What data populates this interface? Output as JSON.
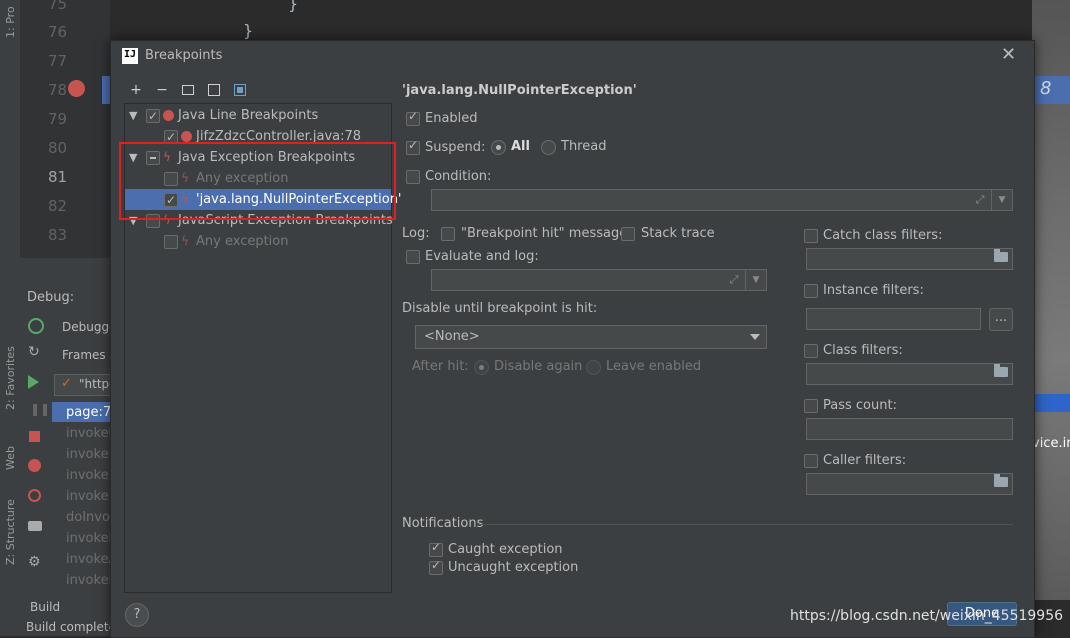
{
  "ide": {
    "left_tabs": [
      "1: Pro",
      "2: Favorites",
      "Web",
      "Z: Structure"
    ],
    "line_numbers": [
      "75",
      "76",
      "77",
      "78",
      "79",
      "80",
      "81",
      "82",
      "83"
    ],
    "code_braces": [
      "}",
      "}"
    ],
    "debug_label": "Debug:",
    "debugger_tab": "Debugge",
    "frames_tab": "Frames",
    "thread_value": "\"http-",
    "frames": [
      "page:78",
      "invoke0",
      "invoke:6",
      "invoke:4",
      "invoke:4",
      "doInvo",
      "invokeF",
      "invokeA",
      "invokeH"
    ],
    "build_label": "Build",
    "status_text": "Build complete",
    "right_snippet": "vice.im",
    "right_digit": "8"
  },
  "dialog": {
    "title": "Breakpoints",
    "close_icon": "close-icon",
    "toolbar": [
      "add-icon",
      "remove-icon",
      "group-folder-icon",
      "group-package-icon",
      "restore-icon"
    ],
    "tree": [
      {
        "label": "Java Line Breakpoints",
        "checked": true,
        "kind": "group"
      },
      {
        "label": "JifzZdzcController.java:78",
        "checked": true,
        "kind": "item"
      },
      {
        "label": "Java Exception Breakpoints",
        "checked": "mixed",
        "kind": "group"
      },
      {
        "label": "Any exception",
        "checked": false,
        "kind": "item"
      },
      {
        "label": "'java.lang.NullPointerException'",
        "checked": true,
        "kind": "item",
        "selected": true
      },
      {
        "label": "JavaScript Exception Breakpoints",
        "checked": false,
        "kind": "group"
      },
      {
        "label": "Any exception",
        "checked": false,
        "kind": "item"
      }
    ],
    "detail": {
      "heading": "'java.lang.NullPointerException'",
      "enabled": "Enabled",
      "suspend": "Suspend:",
      "all": "All",
      "thread": "Thread",
      "condition": "Condition:",
      "log": "Log:",
      "bp_hit_message": "\"Breakpoint hit\" message",
      "stack_trace": "Stack trace",
      "evaluate_and_log": "Evaluate and log:",
      "disable_until": "Disable until breakpoint is hit:",
      "none_option": "<None>",
      "after_hit": "After hit:",
      "disable_again": "Disable again",
      "leave_enabled": "Leave enabled",
      "catch_class_filters": "Catch class filters:",
      "instance_filters": "Instance filters:",
      "class_filters": "Class filters:",
      "pass_count": "Pass count:",
      "caller_filters": "Caller filters:",
      "browse_button": "...",
      "notifications": "Notifications",
      "caught_exception": "Caught exception",
      "uncaught_exception": "Uncaught exception"
    },
    "help_button": "?",
    "done_button": "Done"
  },
  "watermark": "https://blog.csdn.net/weixin_45519956",
  "colors": {
    "selection": "#4b6eaf",
    "highlight_box": "#e0201c",
    "breakpoint_red": "#c75450",
    "dialog_bg": "#3c3f41"
  }
}
